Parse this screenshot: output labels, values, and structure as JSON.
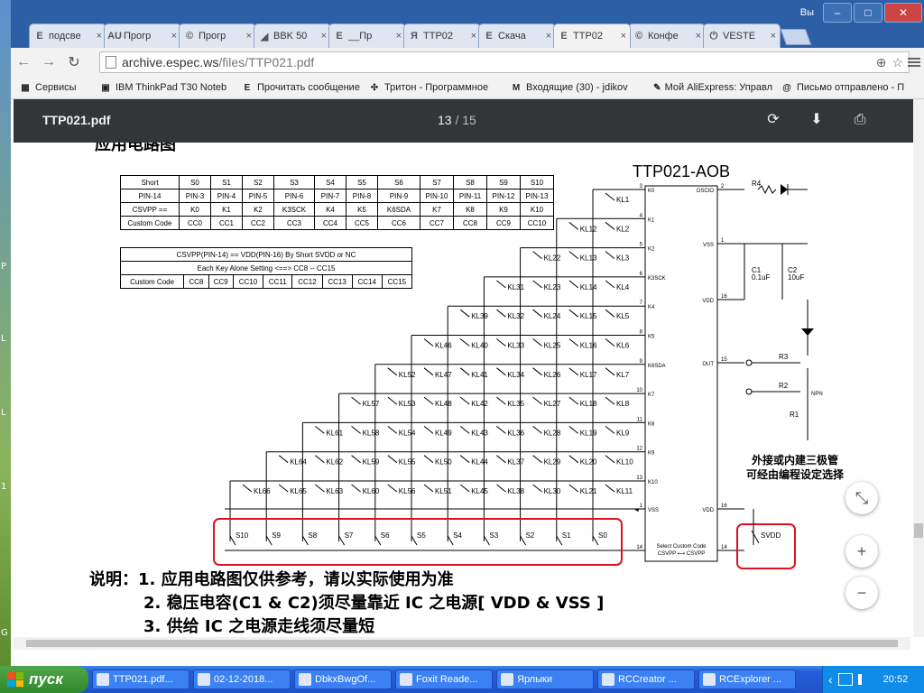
{
  "desktop": {
    "side_letters": [
      "P",
      "L",
      "L",
      "1",
      "G"
    ]
  },
  "window": {
    "caption_lang": "Вы",
    "minimize": "–",
    "maximize": "□",
    "close": "✕"
  },
  "tabs": [
    {
      "icon": "E",
      "label": "подсве"
    },
    {
      "icon": "AU",
      "label": "Прогр"
    },
    {
      "icon": "©",
      "label": "Прогр"
    },
    {
      "icon": "◢",
      "label": "BBK 50"
    },
    {
      "icon": "E",
      "label": "__Пр"
    },
    {
      "icon": "Я",
      "label": "TTP02"
    },
    {
      "icon": "E",
      "label": "Скача"
    },
    {
      "icon": "E",
      "label": "TTP02"
    },
    {
      "icon": "©",
      "label": "Конфе"
    },
    {
      "icon": "⏻",
      "label": "VESTE"
    }
  ],
  "active_tab": 7,
  "tab_close": "×",
  "toolbar": {
    "back": "←",
    "forward": "→",
    "reload": "↻",
    "url_host": "archive.espec.ws",
    "url_path": "/files/TTP021.pdf",
    "zoom_icon": "⊕",
    "star_icon": "☆"
  },
  "bookmarks": [
    {
      "icon": "▦",
      "label": "Сервисы"
    },
    {
      "icon": "▣",
      "label": "IBM ThinkPad T30 Noteb"
    },
    {
      "icon": "E",
      "label": "Прочитать сообщение"
    },
    {
      "icon": "✣",
      "label": "Тритон - Программное"
    },
    {
      "icon": "M",
      "label": "Входящие (30) - jdikov"
    },
    {
      "icon": "✎",
      "label": "Мой AliExpress: Управл"
    },
    {
      "icon": "@",
      "label": "Письмо отправлено - П"
    }
  ],
  "pdf": {
    "title": "TTP021.pdf",
    "page_current": "13",
    "page_sep": "/",
    "page_total": "15",
    "rotate_icon": "⟳",
    "download_icon": "⬇",
    "print_icon": "⎙"
  },
  "schematic": {
    "top_heading": "应用电路图",
    "chip": "TTP021-AOB",
    "table1": [
      [
        "Short",
        "S0",
        "S1",
        "S2",
        "S3",
        "S4",
        "S5",
        "S6",
        "S7",
        "S8",
        "S9",
        "S10"
      ],
      [
        "PIN-14",
        "PIN-3",
        "PIN-4",
        "PIN-5",
        "PIN-6",
        "PIN-7",
        "PIN-8",
        "PIN-9",
        "PIN-10",
        "PIN-11",
        "PIN-12",
        "PIN-13"
      ],
      [
        "CSVPP ==",
        "K0",
        "K1",
        "K2",
        "K3SCK",
        "K4",
        "K5",
        "K6SDA",
        "K7",
        "K8",
        "K9",
        "K10"
      ],
      [
        "Custom Code",
        "CC0",
        "CC1",
        "CC2",
        "CC3",
        "CC4",
        "CC5",
        "CC6",
        "CC7",
        "CC8",
        "CC9",
        "CC10"
      ]
    ],
    "table2_head1": "CSVPP(PIN-14) == VDD(PIN-16) By Short SVDD or NC",
    "table2_head2": "Each Key Alone Setting <==> CC8 -- CC15",
    "table2_row": [
      "Custom Code",
      "CC8",
      "CC9",
      "CC10",
      "CC11",
      "CC12",
      "CC13",
      "CC14",
      "CC15"
    ],
    "pins_left": [
      {
        "num": "3",
        "name": "K0"
      },
      {
        "num": "4",
        "name": "K1"
      },
      {
        "num": "5",
        "name": "K2"
      },
      {
        "num": "6",
        "name": "K3SCK"
      },
      {
        "num": "7",
        "name": "K4"
      },
      {
        "num": "8",
        "name": "K5"
      },
      {
        "num": "9",
        "name": "K6SDA"
      },
      {
        "num": "10",
        "name": "K7"
      },
      {
        "num": "11",
        "name": "K8"
      },
      {
        "num": "12",
        "name": "K9"
      },
      {
        "num": "13",
        "name": "K10"
      },
      {
        "num": "1",
        "name": "VSS"
      },
      {
        "num": "14",
        "name": ""
      }
    ],
    "pins_right": [
      {
        "num": "2",
        "name": "OSCIO"
      },
      {
        "num": "1",
        "name": "VSS"
      },
      {
        "num": "16",
        "name": "VDD"
      },
      {
        "num": "15",
        "name": "OUT"
      },
      {
        "num": "16",
        "name": "VDD"
      },
      {
        "num": "14",
        "name": ""
      }
    ],
    "chip_bottom_1": "Select Custom Code",
    "chip_bottom_2": "CSVPP ⟷ CSVPP",
    "key_rows": [
      [
        "KL1"
      ],
      [
        "KL12",
        "KL2"
      ],
      [
        "KL22",
        "KL13",
        "KL3"
      ],
      [
        "KL31",
        "KL23",
        "KL14",
        "KL4"
      ],
      [
        "KL39",
        "KL32",
        "KL24",
        "KL15",
        "KL5"
      ],
      [
        "KL46",
        "KL40",
        "KL33",
        "KL25",
        "KL16",
        "KL6"
      ],
      [
        "KL52",
        "KL47",
        "KL41",
        "KL34",
        "KL26",
        "KL17",
        "KL7"
      ],
      [
        "KL57",
        "KL53",
        "KL48",
        "KL42",
        "KL35",
        "KL27",
        "KL18",
        "KL8"
      ],
      [
        "KL61",
        "KL58",
        "KL54",
        "KL49",
        "KL43",
        "KL36",
        "KL28",
        "KL19",
        "KL9"
      ],
      [
        "KL64",
        "KL62",
        "KL59",
        "KL55",
        "KL50",
        "KL44",
        "KL37",
        "KL29",
        "KL20",
        "KL10"
      ],
      [
        "KL66",
        "KL65",
        "KL63",
        "KL60",
        "KL56",
        "KL51",
        "KL45",
        "KL38",
        "KL30",
        "KL21",
        "KL11"
      ]
    ],
    "select_switches": [
      "S10",
      "S9",
      "S8",
      "S7",
      "S6",
      "S5",
      "S4",
      "S3",
      "S2",
      "S1",
      "S0"
    ],
    "svdd": "SVDD",
    "parts": {
      "r4": "R4",
      "c1": "C1",
      "c1v": "0.1uF",
      "c2": "C2",
      "c2v": "10uF",
      "r3": "R3",
      "r2": "R2",
      "r1": "R1",
      "npn": "NPN"
    },
    "cn_note_1": "外接或内建三极管",
    "cn_note_2": "可经由编程设定选择",
    "notes": [
      "说明：1. 应用电路图仅供参考，请以实际使用为准",
      "2. 稳压电容(C1 & C2)须尽量靠近 IC 之电源[ VDD & VSS ]",
      "3. 供给 IC 之电源走线须尽量短"
    ]
  },
  "float_buttons": {
    "fit": "⤡",
    "zoom_in": "+",
    "zoom_out": "−"
  },
  "taskbar": {
    "start": "пуск",
    "tasks": [
      "TTP021.pdf...",
      "02-12-2018...",
      "DbkxBwgOf...",
      "Foxit Reade...",
      "Ярлыки",
      "RCCreator ...",
      "RCExplorer ..."
    ],
    "lang": "RU",
    "time": "20:52",
    "tray_arrow": "‹"
  }
}
